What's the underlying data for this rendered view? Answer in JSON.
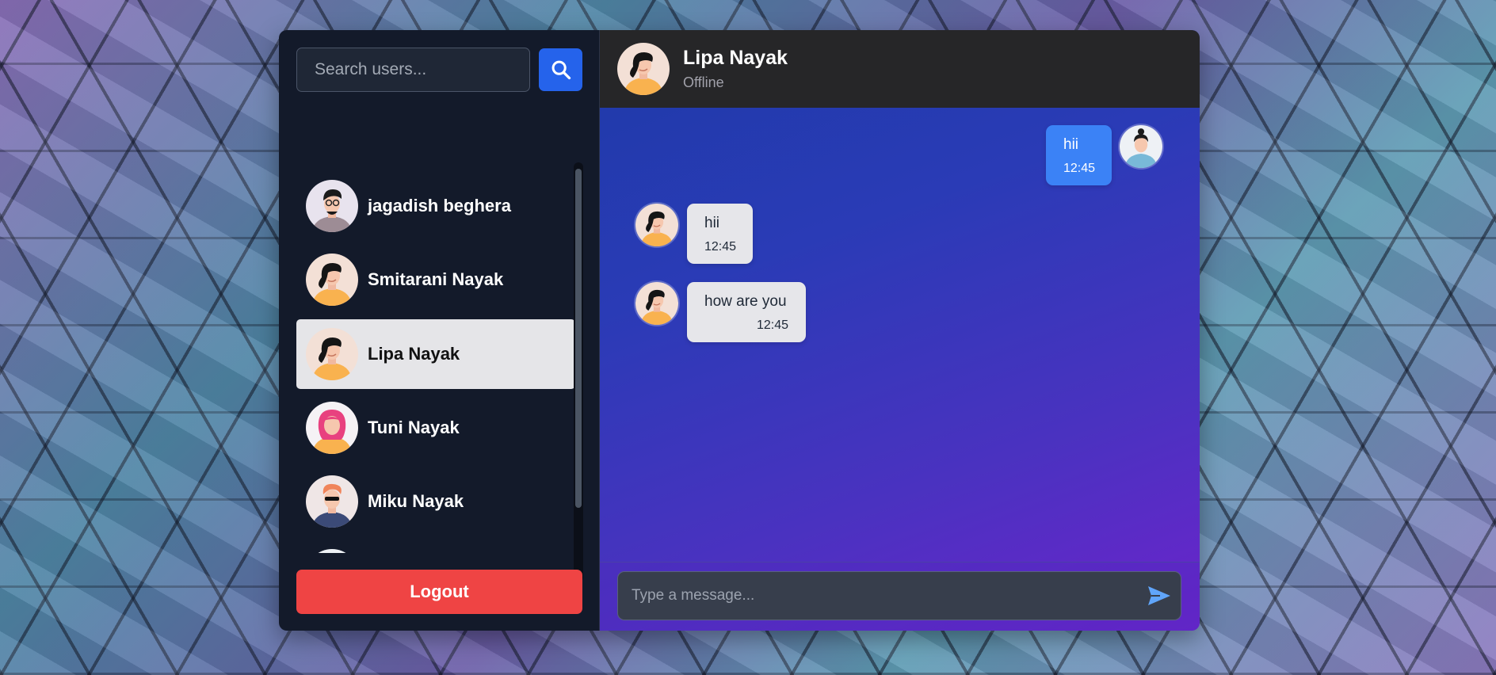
{
  "search": {
    "placeholder": "Search users..."
  },
  "users": [
    {
      "name": "jagadish beghera",
      "avatar": "man-glasses-avatar"
    },
    {
      "name": "Smitarani Nayak",
      "avatar": "woman-avatar"
    },
    {
      "name": "Lipa Nayak",
      "avatar": "woman-avatar",
      "active": true
    },
    {
      "name": "Tuni Nayak",
      "avatar": "pink-hair-woman-avatar"
    },
    {
      "name": "Miku Nayak",
      "avatar": "man-sunglasses-avatar"
    }
  ],
  "logout_label": "Logout",
  "chat": {
    "contact_name": "Lipa Nayak",
    "status": "Offline",
    "messages": [
      {
        "text": "hii",
        "time": "12:45",
        "direction": "outgoing"
      },
      {
        "text": "hii",
        "time": "12:45",
        "direction": "incoming"
      },
      {
        "text": "how are you",
        "time": "12:45",
        "direction": "incoming"
      }
    ],
    "input_placeholder": "Type a message..."
  },
  "colors": {
    "accent": "#2563eb",
    "logout": "#ef4444",
    "outgoing_bubble": "#3b82f6",
    "incoming_bubble": "#e6e6ea",
    "sidebar_bg": "#131a2a",
    "header_bg": "#262628"
  }
}
